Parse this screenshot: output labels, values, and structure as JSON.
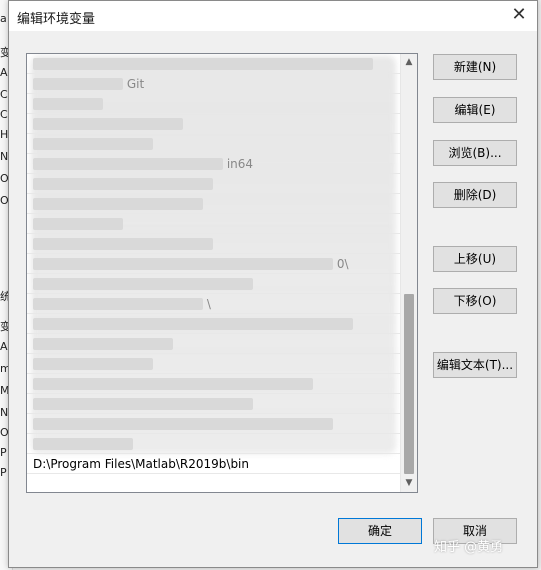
{
  "dialog": {
    "title": "编辑环境变量",
    "close_label": "✕"
  },
  "list": {
    "visible_entry": "D:\\Program Files\\Matlab\\R2019b\\bin",
    "blurred_hints": [
      "Git",
      "in64",
      "0\\",
      "\\"
    ]
  },
  "buttons": {
    "new": "新建(N)",
    "edit": "编辑(E)",
    "browse": "浏览(B)...",
    "delete": "删除(D)",
    "move_up": "上移(U)",
    "move_down": "下移(O)",
    "edit_text": "编辑文本(T)...",
    "ok": "确定",
    "cancel": "取消"
  },
  "background": {
    "left_fragments": [
      "a",
      "变",
      "A",
      "C",
      "C",
      "H",
      "N",
      "O",
      "O",
      "统",
      "变",
      "A",
      "m",
      "M",
      "N",
      "O",
      "P",
      "P"
    ]
  },
  "watermark": {
    "text": "知乎 @黄勇"
  },
  "icons": {
    "scroll_up": "chevron-up-icon",
    "scroll_down": "chevron-down-icon"
  }
}
